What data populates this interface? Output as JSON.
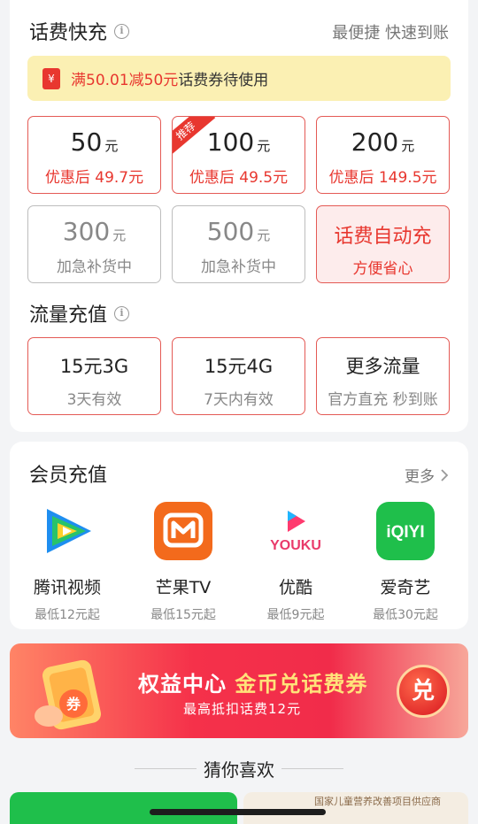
{
  "recharge": {
    "title": "话费快充",
    "tagline": "最便捷 快速到账",
    "coupon": {
      "icon": "yuan-ticket-icon",
      "highlight": "满50.01减50元",
      "text": "话费券待使用"
    },
    "tiles": [
      {
        "amount": "50",
        "unit": "元",
        "price": "优惠后 49.7元"
      },
      {
        "amount": "100",
        "unit": "元",
        "price": "优惠后 49.5元",
        "badge": "推荐"
      },
      {
        "amount": "200",
        "unit": "元",
        "price": "优惠后 149.5元"
      },
      {
        "amount": "300",
        "unit": "元",
        "price": "加急补货中"
      },
      {
        "amount": "500",
        "unit": "元",
        "price": "加急补货中"
      },
      {
        "title": "话费自动充",
        "sub": "方便省心"
      }
    ]
  },
  "data": {
    "title": "流量充值",
    "tiles": [
      {
        "title": "15元3G",
        "sub": "3天有效"
      },
      {
        "title": "15元4G",
        "sub": "7天内有效"
      },
      {
        "title": "更多流量",
        "sub": "官方直充 秒到账"
      }
    ]
  },
  "vip": {
    "title": "会员充值",
    "more": "更多",
    "apps": [
      {
        "name": "腾讯视频",
        "price": "最低12元起",
        "icon": "tencent-video-icon"
      },
      {
        "name": "芒果TV",
        "price": "最低15元起",
        "icon": "mango-tv-icon"
      },
      {
        "name": "优酷",
        "price": "最低9元起",
        "icon": "youku-icon",
        "logo_text": "YOUKU"
      },
      {
        "name": "爱奇艺",
        "price": "最低30元起",
        "icon": "iqiyi-icon",
        "logo_text": "iQIYI"
      }
    ]
  },
  "banner": {
    "title_a": "权益中心",
    "title_b": "金币兑话费券",
    "sub": "最高抵扣话费12元",
    "button": "兑",
    "art_label": "券"
  },
  "guess": {
    "title": "猜你喜欢"
  },
  "peek": {
    "beige_text": "国家儿童营养改善项目供应商"
  },
  "colors": {
    "accent": "#e8372f",
    "coupon_bg": "#fbf0b3",
    "iqiyi": "#1fbf4b",
    "mango": "#f36a1c"
  }
}
